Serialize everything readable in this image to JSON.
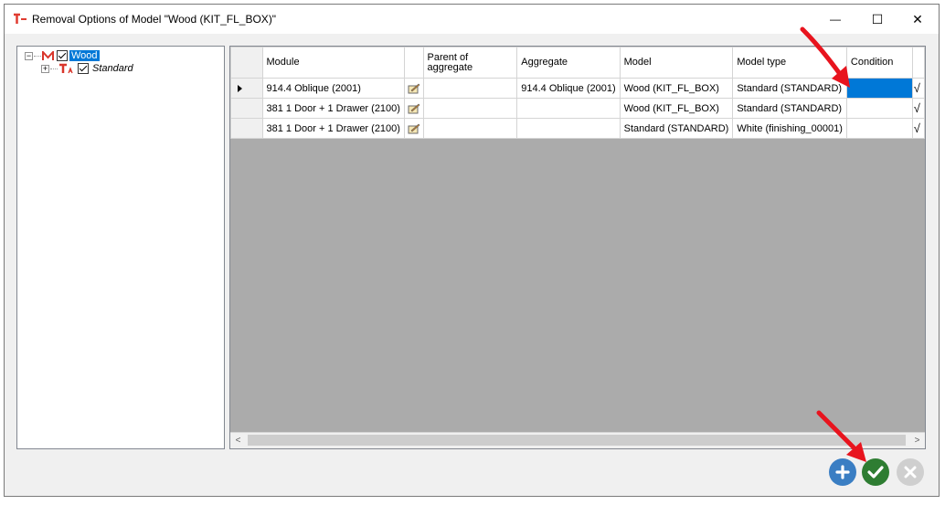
{
  "window": {
    "title": "Removal Options of Model \"Wood (KIT_FL_BOX)\"",
    "minimize": "—",
    "maximize": "☐",
    "close": "✕"
  },
  "tree": {
    "root": {
      "label": "Wood",
      "expander": "−",
      "checked": true
    },
    "child": {
      "label": "Standard",
      "expander": "+",
      "checked": true
    }
  },
  "grid": {
    "columns": [
      "Module",
      "Parent of aggregate",
      "Aggregate",
      "Model",
      "Model type",
      "Condition"
    ],
    "rows": [
      {
        "module": "914.4 Oblique (2001)",
        "parent": "",
        "aggregate": "914.4 Oblique (2001)",
        "model": "Wood (KIT_FL_BOX)",
        "model_type": "Standard (STANDARD)",
        "condition": "",
        "extra": "√"
      },
      {
        "module": "381 1 Door + 1 Drawer (2100)",
        "parent": "",
        "aggregate": "",
        "model": "Wood (KIT_FL_BOX)",
        "model_type": "Standard (STANDARD)",
        "condition": "",
        "extra": "√"
      },
      {
        "module": "381 1 Door + 1 Drawer (2100)",
        "parent": "",
        "aggregate": "",
        "model": "Standard (STANDARD)",
        "model_type": "White (finishing_00001)",
        "condition": "",
        "extra": "√"
      }
    ],
    "scroll_left": "<",
    "scroll_right": ">"
  },
  "buttons": {
    "add": "add-circle-icon",
    "ok": "check-circle-icon",
    "cancel": "x-circle-icon"
  },
  "colors": {
    "selection": "#0078d7",
    "add": "#3a7ec3",
    "ok": "#2e7d32",
    "cancel_disabled": "#cfcfcf",
    "annotation_arrow": "#e8141e"
  }
}
